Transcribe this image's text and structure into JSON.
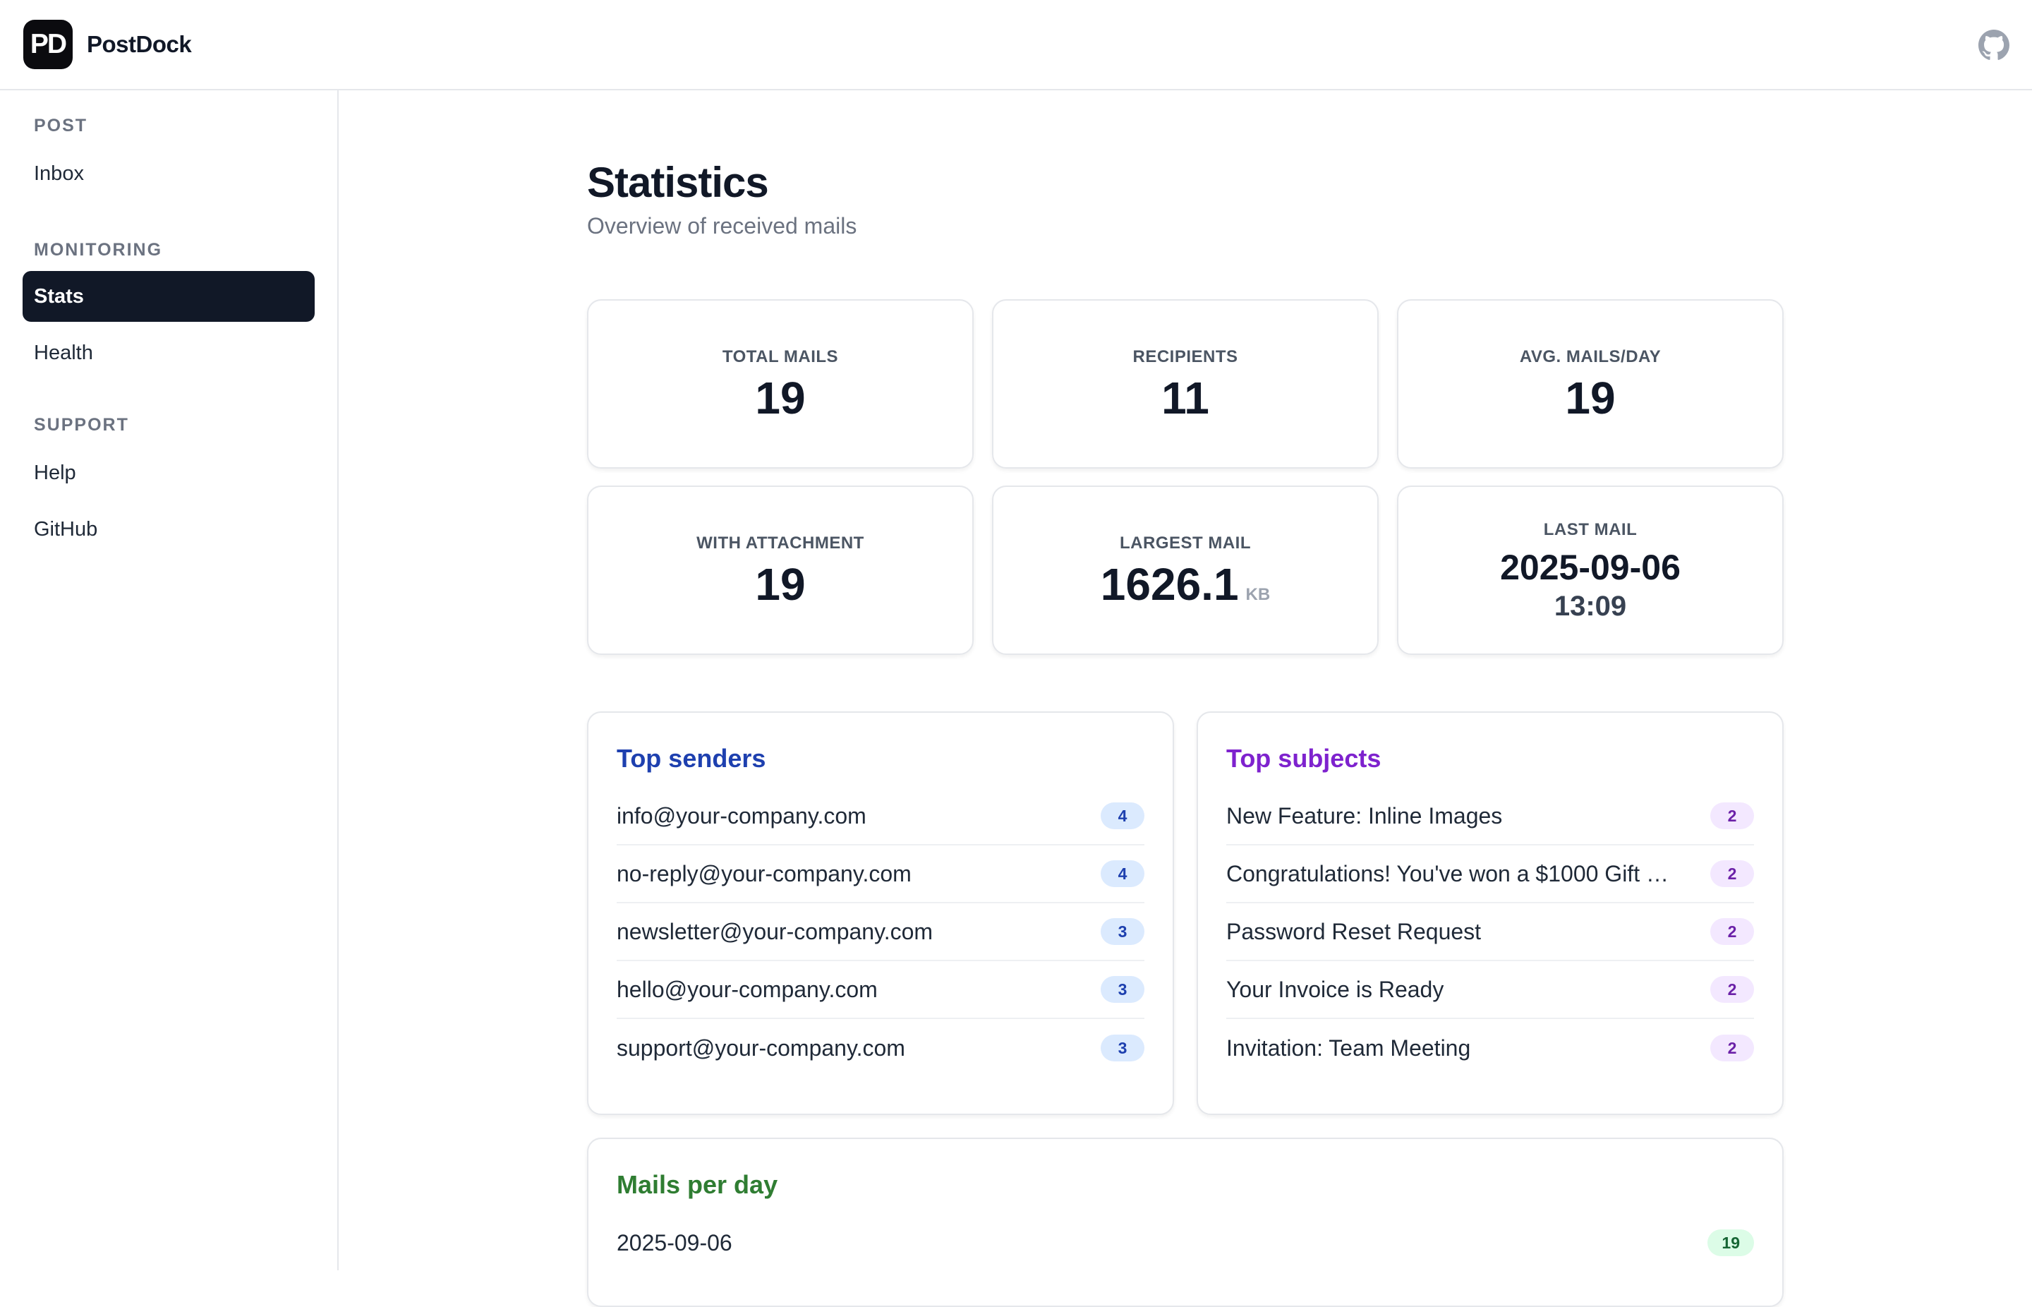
{
  "app": {
    "logo_text": "PD",
    "name": "PostDock"
  },
  "header": {
    "github_icon": "github-icon"
  },
  "sidebar": {
    "sections": [
      {
        "heading": "POST",
        "items": [
          {
            "label": "Inbox"
          }
        ]
      },
      {
        "heading": "MONITORING",
        "items": [
          {
            "label": "Stats",
            "active": true
          },
          {
            "label": "Health"
          }
        ]
      },
      {
        "heading": "SUPPORT",
        "items": [
          {
            "label": "Help"
          },
          {
            "label": "GitHub"
          }
        ]
      }
    ]
  },
  "page": {
    "title": "Statistics",
    "subtitle": "Overview of received mails"
  },
  "stats": {
    "total_mails": {
      "label": "TOTAL MAILS",
      "value": "19"
    },
    "recipients": {
      "label": "RECIPIENTS",
      "value": "11"
    },
    "avg_mails_day": {
      "label": "AVG. MAILS/DAY",
      "value": "19"
    },
    "with_attachment": {
      "label": "WITH ATTACHMENT",
      "value": "19"
    },
    "largest_mail": {
      "label": "LARGEST MAIL",
      "value": "1626.1",
      "unit": "KB"
    },
    "last_mail": {
      "label": "LAST MAIL",
      "date": "2025-09-06",
      "time": "13:09"
    }
  },
  "top_senders": {
    "title": "Top senders",
    "color": "#1e40af",
    "items": [
      {
        "text": "info@your-company.com",
        "count": "4"
      },
      {
        "text": "no-reply@your-company.com",
        "count": "4"
      },
      {
        "text": "newsletter@your-company.com",
        "count": "3"
      },
      {
        "text": "hello@your-company.com",
        "count": "3"
      },
      {
        "text": "support@your-company.com",
        "count": "3"
      }
    ]
  },
  "top_subjects": {
    "title": "Top subjects",
    "color": "#7e22ce",
    "items": [
      {
        "text": "New Feature: Inline Images",
        "count": "2"
      },
      {
        "text": "Congratulations! You've won a $1000 Gift C...",
        "count": "2"
      },
      {
        "text": "Password Reset Request",
        "count": "2"
      },
      {
        "text": "Your Invoice is Ready",
        "count": "2"
      },
      {
        "text": "Invitation: Team Meeting",
        "count": "2"
      }
    ]
  },
  "mails_per_day": {
    "title": "Mails per day",
    "color": "#2f7d32",
    "items": [
      {
        "date": "2025-09-06",
        "count": "19"
      }
    ]
  }
}
